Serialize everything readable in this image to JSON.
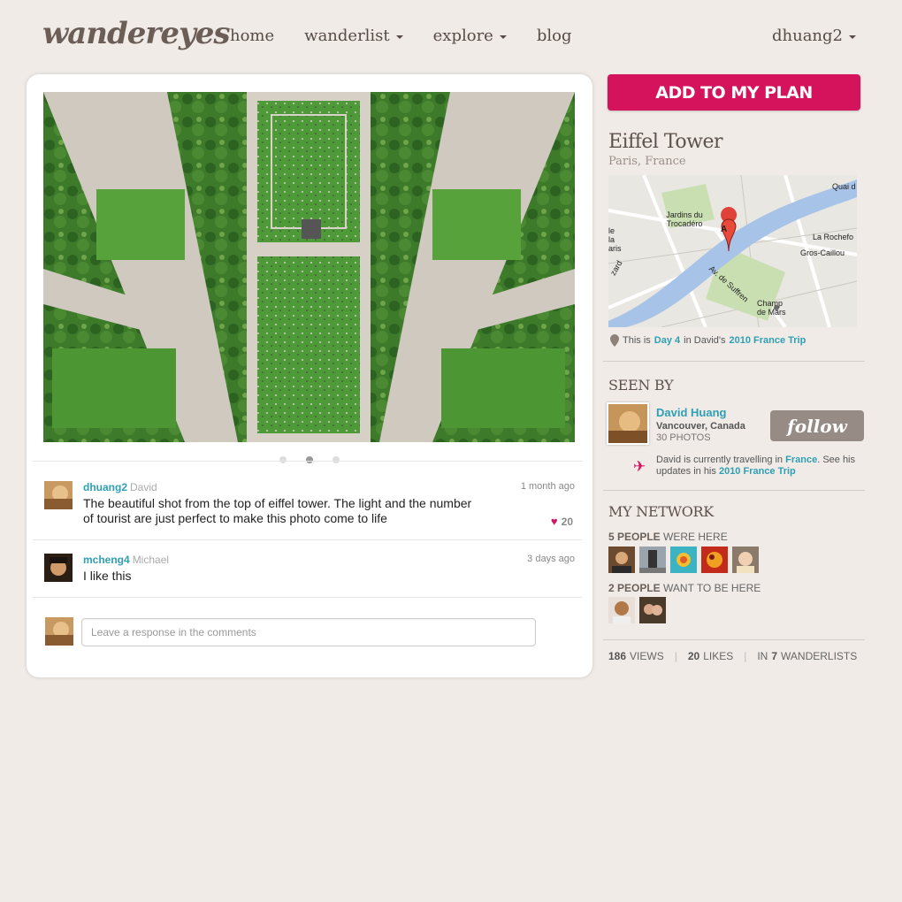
{
  "brand": {
    "logo": "wandereyes"
  },
  "nav": {
    "home": "home",
    "wanderlist": "wanderlist",
    "explore": "explore",
    "blog": "blog"
  },
  "user": {
    "username": "dhuang2"
  },
  "carousel": {
    "count": 3,
    "active_index": 1
  },
  "comments": [
    {
      "username": "dhuang2",
      "realname": "David",
      "time": "1 month ago",
      "text": "The beautiful shot from the top of eiffel tower. The light and the number of tourist are just perfect to make this photo come to life",
      "likes": "20"
    },
    {
      "username": "mcheng4",
      "realname": "Michael",
      "time": "3 days ago",
      "text": "I like this"
    }
  ],
  "reply": {
    "placeholder": "Leave a response in the comments"
  },
  "sidebar": {
    "add_button": "ADD TO MY PLAN",
    "place_name": "Eiffel Tower",
    "place_location": "Paris, France",
    "map": {
      "pin_letter": "A",
      "labels": {
        "jardins": "Jardins du Trocadéro",
        "quai": "Quai d",
        "rochefo": "La Rochefo",
        "gros": "Gros-Caillou",
        "la_paris": "le la aris",
        "champ": "Champ de Mars",
        "suffren": "Av. de Suffren",
        "izard": "zard"
      }
    },
    "trip": {
      "prefix": "This is",
      "day": "Day 4",
      "mid": "in David's",
      "trip_name": "2010 France Trip"
    },
    "seen_by": {
      "heading": "SEEN BY",
      "name": "David Huang",
      "location": "Vancouver, Canada",
      "photos": "30 PHOTOS",
      "follow_label": "follow",
      "travel_prefix": "David is currently travelling in",
      "travel_place": "France",
      "travel_mid": ". See his updates in his",
      "travel_trip": "2010 France Trip"
    },
    "network": {
      "heading": "MY NETWORK",
      "were_count": "5 PEOPLE",
      "were_label": "WERE HERE",
      "want_count": "2 PEOPLE",
      "want_label": "WANT TO BE HERE"
    },
    "stats": {
      "views_num": "186",
      "views_label": "VIEWS",
      "likes_num": "20",
      "likes_label": "LIKES",
      "in_label": "IN",
      "lists_num": "7",
      "lists_label": "WANDERLISTS"
    }
  },
  "colors": {
    "brand_pink": "#d5135d",
    "link_blue": "#2f9fb4",
    "background": "#f0ebe7",
    "follow_gray": "#978c85"
  }
}
